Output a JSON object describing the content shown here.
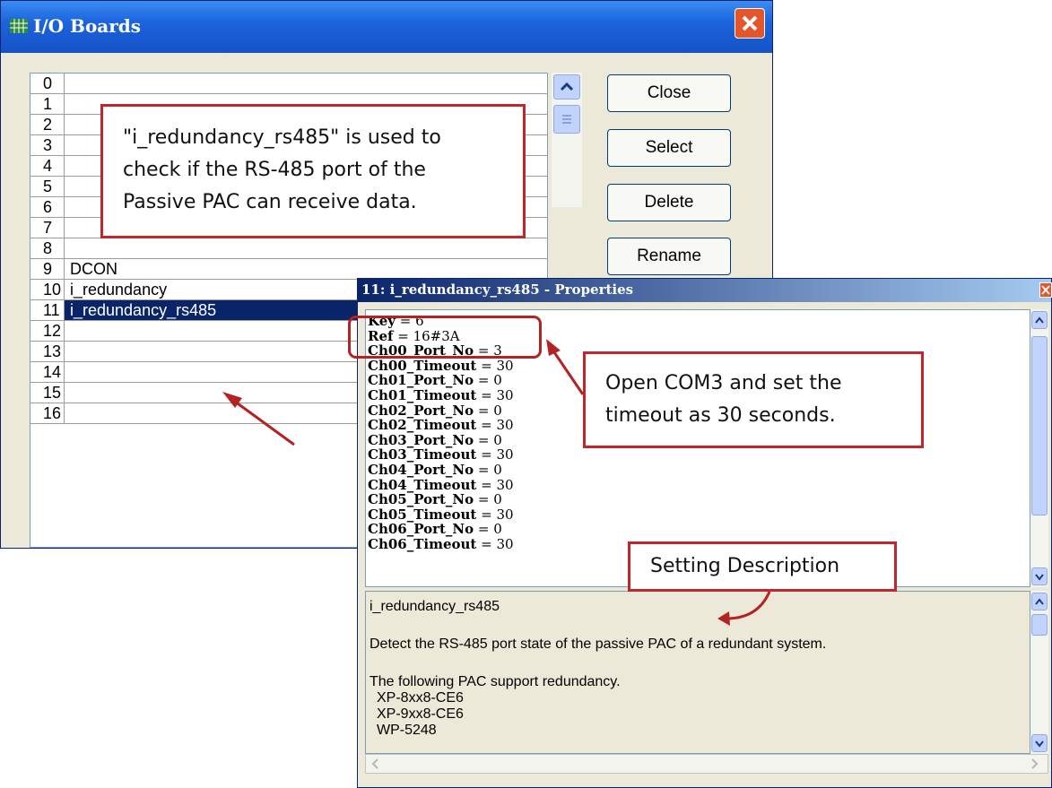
{
  "io_window": {
    "title": "I/O Boards",
    "rows": [
      {
        "num": "0",
        "name": ""
      },
      {
        "num": "1",
        "name": ""
      },
      {
        "num": "2",
        "name": ""
      },
      {
        "num": "3",
        "name": ""
      },
      {
        "num": "4",
        "name": ""
      },
      {
        "num": "5",
        "name": ""
      },
      {
        "num": "6",
        "name": ""
      },
      {
        "num": "7",
        "name": ""
      },
      {
        "num": "8",
        "name": ""
      },
      {
        "num": "9",
        "name": "DCON"
      },
      {
        "num": "10",
        "name": "i_redundancy"
      },
      {
        "num": "11",
        "name": "i_redundancy_rs485"
      },
      {
        "num": "12",
        "name": ""
      },
      {
        "num": "13",
        "name": ""
      },
      {
        "num": "14",
        "name": ""
      },
      {
        "num": "15",
        "name": ""
      },
      {
        "num": "16",
        "name": ""
      }
    ],
    "selected_row": "11",
    "buttons": {
      "close": "Close",
      "select": "Select",
      "delete": "Delete",
      "rename": "Rename"
    }
  },
  "properties_window": {
    "title": "11: i_redundancy_rs485 - Properties",
    "params": [
      {
        "key": "Key",
        "value": "6"
      },
      {
        "key": "Ref",
        "value": "16#3A"
      },
      {
        "key": "Ch00_Port_No",
        "value": "3"
      },
      {
        "key": "Ch00_Timeout",
        "value": "30"
      },
      {
        "key": "Ch01_Port_No",
        "value": "0"
      },
      {
        "key": "Ch01_Timeout",
        "value": "30"
      },
      {
        "key": "Ch02_Port_No",
        "value": "0"
      },
      {
        "key": "Ch02_Timeout",
        "value": "30"
      },
      {
        "key": "Ch03_Port_No",
        "value": "0"
      },
      {
        "key": "Ch03_Timeout",
        "value": "30"
      },
      {
        "key": "Ch04_Port_No",
        "value": "0"
      },
      {
        "key": "Ch04_Timeout",
        "value": "30"
      },
      {
        "key": "Ch05_Port_No",
        "value": "0"
      },
      {
        "key": "Ch05_Timeout",
        "value": "30"
      },
      {
        "key": "Ch06_Port_No",
        "value": "0"
      },
      {
        "key": "Ch06_Timeout",
        "value": "30"
      }
    ],
    "description": {
      "name": "i_redundancy_rs485",
      "summary": "Detect the RS-485 port state of the passive PAC of a redundant system.",
      "support_heading": "The following PAC support redundancy.",
      "models": [
        "XP-8xx8-CE6",
        "XP-9xx8-CE6",
        "WP-5248"
      ]
    }
  },
  "annotations": {
    "rs485_note": [
      "\"i_redundancy_rs485\" is used to",
      "check if the RS-485 port of the",
      "Passive PAC can receive data."
    ],
    "com3_note": [
      "Open COM3 and set the",
      "timeout as 30 seconds."
    ],
    "setting_description": "Setting Description"
  },
  "colors": {
    "annotation_red": "#c0272d",
    "selection_blue": "#0a246a",
    "title_blue": "#1c64dd"
  }
}
